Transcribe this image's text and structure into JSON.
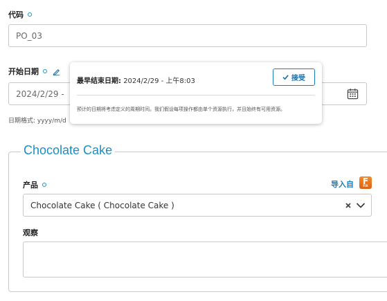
{
  "code": {
    "label": "代码",
    "value": "PO_03"
  },
  "start_date": {
    "label": "开始日期",
    "value": "2024/2/29 - ",
    "format_hint": "日期格式: yyyy/m/d"
  },
  "popover": {
    "title_label": "最早结束日期:",
    "title_value": "2024/2/29 - 上午8:03",
    "accept_label": "接受",
    "note": "预计的日期将考虑定义的周期时间。我们假设每项操作都由单个资源执行，并且始终有可用资源。"
  },
  "product_group": {
    "title": "Chocolate Cake",
    "product_label": "产品",
    "import_label": "导入自",
    "import_badge": "F",
    "import_badge_sub": "FIX",
    "product_value": "Chocolate Cake ( Chocolate Cake )",
    "observation_label": "观察",
    "observation_value": ""
  },
  "colors": {
    "accent": "#1b8ec4",
    "badge": "#e8741f"
  }
}
